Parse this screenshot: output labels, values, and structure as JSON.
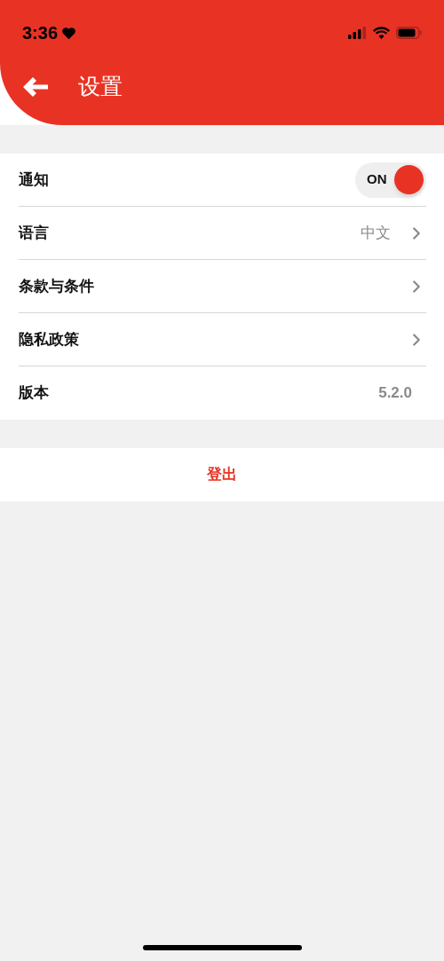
{
  "status_bar": {
    "time": "3:36"
  },
  "header": {
    "title": "设置"
  },
  "settings": [
    {
      "kind": "toggle",
      "label": "通知",
      "toggle_label": "ON",
      "on": true
    },
    {
      "kind": "link",
      "label": "语言",
      "value": "中文"
    },
    {
      "kind": "link",
      "label": "条款与条件"
    },
    {
      "kind": "link",
      "label": "隐私政策"
    },
    {
      "kind": "info",
      "label": "版本",
      "value": "5.2.0"
    }
  ],
  "logout": {
    "label": "登出"
  }
}
